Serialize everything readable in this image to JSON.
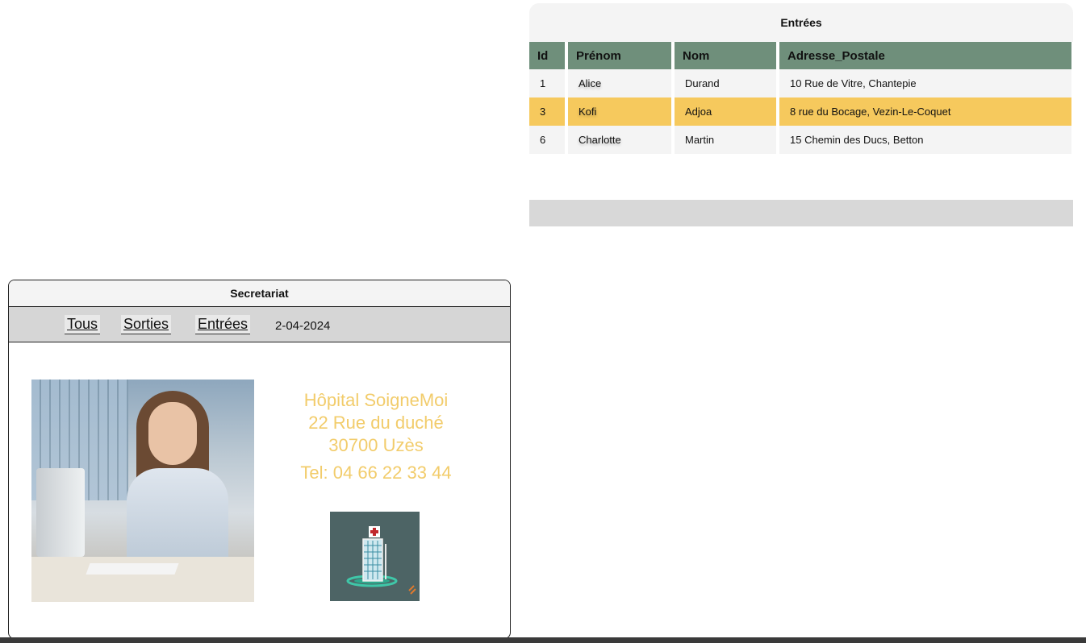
{
  "entries": {
    "title": "Entrées",
    "columns": [
      "Id",
      "Prénom",
      "Nom",
      "Adresse_Postale"
    ],
    "rows": [
      {
        "id": "1",
        "prenom": "Alice",
        "nom": "Durand",
        "adresse": "10 Rue de Vitre, Chantepie"
      },
      {
        "id": "3",
        "prenom": "Kofi",
        "nom": "Adjoa",
        "adresse": "8 rue du Bocage, Vezin-Le-Coquet"
      },
      {
        "id": "6",
        "prenom": "Charlotte",
        "nom": "Martin",
        "adresse": "15 Chemin des Ducs, Betton"
      }
    ],
    "selected_row_index": 1
  },
  "secretariat": {
    "title": "Secretariat",
    "nav": {
      "tous": "Tous",
      "sorties": "Sorties",
      "entrees": "Entrées",
      "date": "2-04-2024"
    },
    "hospital": {
      "name": "Hôpital SoigneMoi",
      "street": "22 Rue du duché",
      "city": "30700 Uzès",
      "tel": "Tel: 04 66 22 33 44"
    }
  },
  "colors": {
    "header_green": "#6f8f7b",
    "selected_row": "#f6c95d",
    "hospital_text": "#f2cc6b",
    "logo_bg": "#4d6465"
  }
}
